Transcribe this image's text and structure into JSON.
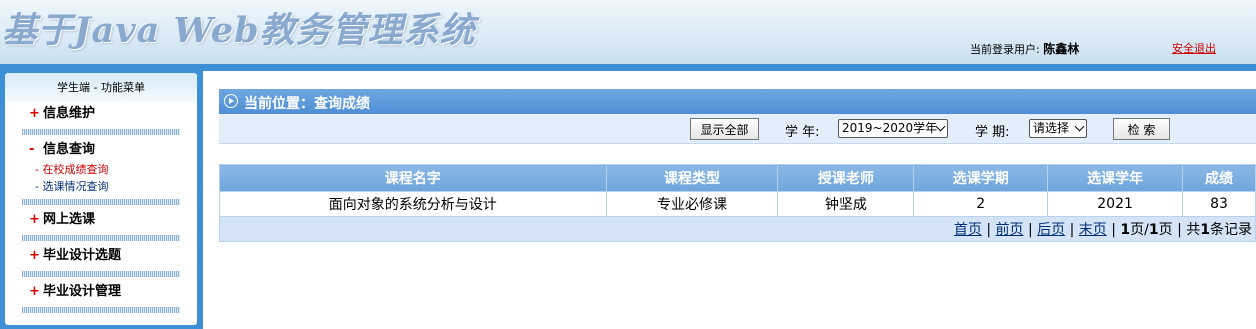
{
  "header": {
    "title": "基于Java Web教务管理系统",
    "user_label": "当前登录用户:",
    "user_name": "陈鑫林",
    "logout": "安全退出"
  },
  "sidebar": {
    "header": "学生端 - 功能菜单",
    "groups": [
      {
        "sign": "+",
        "label": "信息维护",
        "items": []
      },
      {
        "sign": "-",
        "label": "信息查询",
        "items": [
          {
            "label": "在校成绩查询",
            "active": true
          },
          {
            "label": "选课情况查询",
            "active": false
          }
        ]
      },
      {
        "sign": "+",
        "label": "网上选课",
        "items": []
      },
      {
        "sign": "+",
        "label": "毕业设计选题",
        "items": []
      },
      {
        "sign": "+",
        "label": "毕业设计管理",
        "items": []
      }
    ],
    "sub_prefix": "-"
  },
  "location": {
    "text": "当前位置：查询成绩"
  },
  "filters": {
    "show_all": "显示全部",
    "year_label": "学 年:",
    "year_value": "2019~2020学年",
    "term_label": "学 期:",
    "term_value": "请选择",
    "search": "检 索"
  },
  "table": {
    "columns": [
      "课程名字",
      "课程类型",
      "授课老师",
      "选课学期",
      "选课学年",
      "成绩"
    ],
    "rows": [
      [
        "面向对象的系统分析与设计",
        "专业必修课",
        "钟坚成",
        "2",
        "2021",
        "83"
      ]
    ]
  },
  "pager": {
    "first": "首页",
    "prev": "前页",
    "next": "后页",
    "last": "末页",
    "sep": "|",
    "current": "1",
    "page_sep": "页/",
    "total": "1",
    "page_suffix": "页",
    "count_prefix": "共",
    "count": "1",
    "count_suffix": "条记录"
  }
}
